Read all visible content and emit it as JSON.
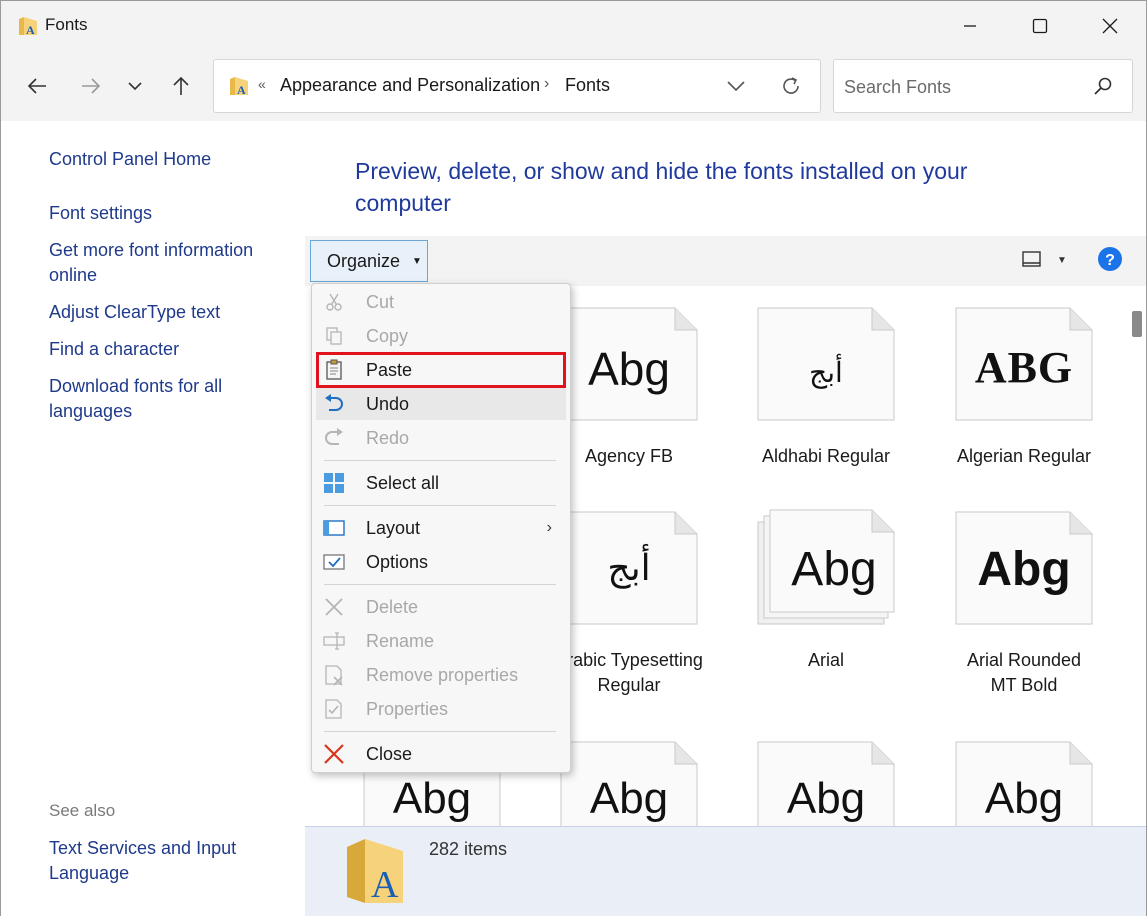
{
  "window": {
    "title": "Fonts"
  },
  "nav": {
    "breadcrumb_overflow": "«",
    "breadcrumb": [
      "Appearance and Personalization",
      "Fonts"
    ],
    "breadcrumb_sep": "›",
    "search_placeholder": "Search Fonts"
  },
  "sidebar": {
    "home": "Control Panel Home",
    "links": [
      "Font settings",
      "Get more font information online",
      "Adjust ClearType text",
      "Find a character",
      "Download fonts for all languages"
    ],
    "see_also_label": "See also",
    "see_also_links": [
      "Text Services and Input Language"
    ]
  },
  "main": {
    "heading": "Preview, delete, or show and hide the fonts installed on your computer",
    "organize_label": "Organize",
    "fonts": [
      {
        "name": "Agency FB",
        "preview": "Abg"
      },
      {
        "name": "Aldhabi Regular",
        "preview": "أبج"
      },
      {
        "name": "Algerian Regular",
        "preview": "ABG"
      },
      {
        "name": "Arabic Typesetting Regular",
        "preview": "أبج"
      },
      {
        "name": "Arial",
        "preview": "Abg"
      },
      {
        "name": "Arial Rounded MT Bold",
        "preview": "Abg"
      },
      {
        "name": "",
        "preview": "Abg"
      },
      {
        "name": "",
        "preview": "Abg"
      },
      {
        "name": "",
        "preview": "Abg"
      },
      {
        "name": "",
        "preview": "Abg"
      }
    ]
  },
  "status": {
    "item_count": "282 items"
  },
  "menu": {
    "items": [
      {
        "label": "Cut",
        "enabled": false
      },
      {
        "label": "Copy",
        "enabled": false
      },
      {
        "label": "Paste",
        "enabled": true
      },
      {
        "label": "Undo",
        "enabled": true
      },
      {
        "label": "Redo",
        "enabled": false
      },
      {
        "label": "Select all",
        "enabled": true
      },
      {
        "label": "Layout",
        "enabled": true
      },
      {
        "label": "Options",
        "enabled": true
      },
      {
        "label": "Delete",
        "enabled": false
      },
      {
        "label": "Rename",
        "enabled": false
      },
      {
        "label": "Remove properties",
        "enabled": false
      },
      {
        "label": "Properties",
        "enabled": false
      },
      {
        "label": "Close",
        "enabled": true
      }
    ]
  },
  "colors": {
    "accent": "#1f3a9c",
    "highlight_box": "#e0141e",
    "help": "#1a73e8"
  }
}
